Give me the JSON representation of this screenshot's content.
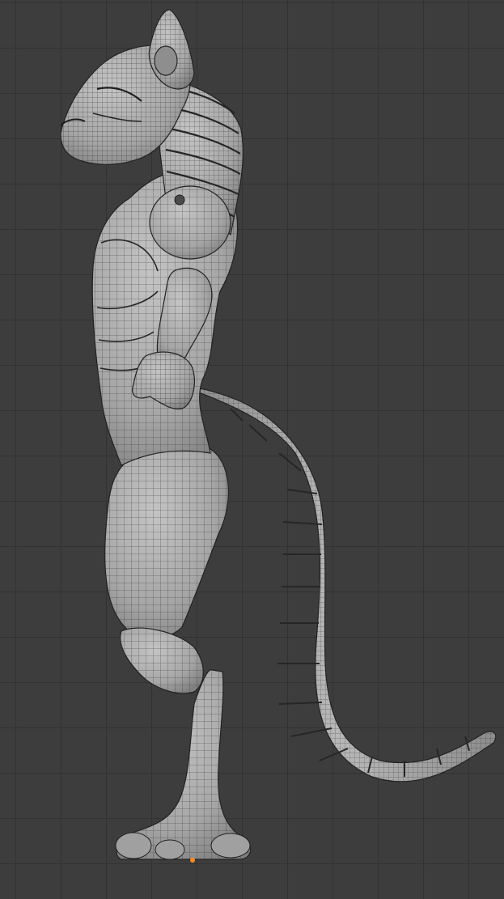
{
  "viewport": {
    "background_color": "#3d3d3d",
    "grid_color": "#323232",
    "mesh_fill": "#a8a8a8",
    "wire_color": "#2a2a2a",
    "origin_color": "#ff8c1a"
  },
  "scene": {
    "object": "creature-mesh",
    "view": "side",
    "display": "wireframe-overlay"
  }
}
